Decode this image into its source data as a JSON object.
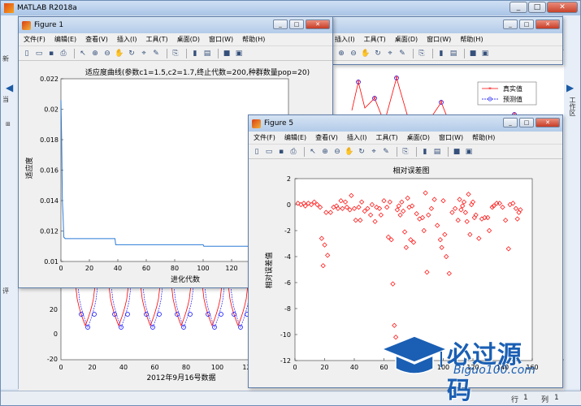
{
  "main_window": {
    "title": "MATLAB R2018a",
    "left_labels": [
      "新",
      "当",
      "评"
    ],
    "right_label": "工作区",
    "status_row_label": "行",
    "status_row_value": "1",
    "status_col_label": "列",
    "status_col_value": "1"
  },
  "menus": [
    "文件(F)",
    "编辑(E)",
    "查看(V)",
    "插入(I)",
    "工具(T)",
    "桌面(D)",
    "窗口(W)",
    "帮助(H)"
  ],
  "background_plot": {
    "xlabel": "2012年9月16号数据",
    "y_ticks": [
      "40",
      "20",
      "0",
      "-20"
    ],
    "x_ticks": [
      "0",
      "20",
      "40",
      "60",
      "80",
      "100",
      "120",
      "14"
    ],
    "legend": [
      "真实值",
      "预测值"
    ],
    "colors": {
      "real": "#ff0000",
      "pred": "#0000ff"
    }
  },
  "figure1": {
    "title": "Figure 1",
    "chart_data": {
      "type": "line",
      "title": "适应度曲线(参数c1=1.5,c2=1.7,终止代数=200,种群数量pop=20)",
      "xlabel": "进化代数",
      "ylabel": "适应度",
      "xlim": [
        0,
        160
      ],
      "ylim": [
        0.01,
        0.022
      ],
      "y_ticks": [
        "0.022",
        "0.02",
        "0.018",
        "0.016",
        "0.014",
        "0.012",
        "0.01"
      ],
      "x_ticks": [
        "0",
        "20",
        "40",
        "60",
        "80",
        "100",
        "120",
        "140"
      ],
      "series": [
        {
          "color": "#2b7bd6",
          "x": [
            0,
            0.5,
            1,
            1.5,
            2,
            3,
            20,
            38,
            38.5,
            60,
            100,
            100.5,
            160
          ],
          "y": [
            0.0206,
            0.018,
            0.014,
            0.013,
            0.0116,
            0.0115,
            0.0115,
            0.0115,
            0.0111,
            0.0111,
            0.0111,
            0.011,
            0.011
          ]
        }
      ]
    }
  },
  "figure5": {
    "title": "Figure 5",
    "chart_data": {
      "type": "scatter",
      "title": "相对误差图",
      "xlabel": "",
      "ylabel": "相对误差值",
      "xlim": [
        0,
        160
      ],
      "ylim": [
        -12,
        2
      ],
      "y_ticks": [
        "2",
        "0",
        "-2",
        "-4",
        "-6",
        "-8",
        "-10",
        "-12"
      ],
      "x_ticks": [
        "0",
        "20",
        "40",
        "60",
        "80",
        "100",
        "120",
        "140",
        "160"
      ],
      "marker": "diamond",
      "color": "#ff0000",
      "x": [
        2,
        4,
        6,
        7,
        9,
        11,
        13,
        15,
        17,
        18,
        19,
        20,
        21,
        22,
        24,
        26,
        28,
        29,
        31,
        32,
        34,
        35,
        37,
        38,
        40,
        41,
        43,
        44,
        45,
        47,
        49,
        51,
        52,
        54,
        55,
        57,
        58,
        60,
        62,
        63,
        64,
        65,
        66,
        67,
        68,
        69,
        70,
        71,
        72,
        73,
        74,
        75,
        76,
        77,
        78,
        79,
        80,
        82,
        84,
        86,
        87,
        88,
        89,
        90,
        92,
        94,
        96,
        98,
        99,
        100,
        101,
        102,
        104,
        106,
        108,
        110,
        111,
        112,
        113,
        114,
        115,
        116,
        117,
        118,
        119,
        120,
        121,
        122,
        124,
        126,
        128,
        130,
        131,
        133,
        134,
        136,
        138,
        140,
        142,
        144,
        145,
        147,
        149,
        150,
        151,
        152
      ],
      "y": [
        0.1,
        0.0,
        0.1,
        -0.1,
        0.1,
        0.0,
        0.2,
        0.0,
        -0.2,
        -2.6,
        -4.7,
        -3.1,
        -0.6,
        -3.9,
        -0.6,
        -0.2,
        -0.1,
        -0.3,
        0.3,
        -0.3,
        0.2,
        -0.2,
        -0.4,
        0.7,
        -0.3,
        -1.2,
        -0.2,
        -1.2,
        0.2,
        -0.5,
        -0.3,
        -0.8,
        0.0,
        -1.3,
        -0.2,
        -0.3,
        -0.8,
        0.3,
        -0.2,
        -2.5,
        0.2,
        -2.7,
        -6.1,
        -9.3,
        -10.2,
        -0.4,
        -0.1,
        -0.8,
        0.2,
        -0.5,
        -2.1,
        -3.3,
        0.5,
        -0.2,
        -2.7,
        -0.1,
        -2.9,
        -0.7,
        -1.1,
        -1.0,
        -2.0,
        0.9,
        -5.2,
        -0.8,
        -0.3,
        0.4,
        -1.6,
        -2.7,
        -3.3,
        0.3,
        -2.3,
        -4.0,
        -5.3,
        -0.6,
        -0.3,
        -1.2,
        0.4,
        -0.4,
        -0.1,
        0.2,
        -0.6,
        -1.3,
        0.8,
        -2.3,
        0.0,
        0.2,
        -1.0,
        -0.8,
        -2.6,
        -1.1,
        -1.0,
        -1.0,
        -2.0,
        -0.2,
        -0.1,
        0.1,
        0.1,
        -0.2,
        -1.2,
        -3.4,
        0.0,
        0.1,
        -0.3,
        -1.1,
        -0.6,
        -0.4
      ]
    }
  },
  "watermark": {
    "main": "必过源码",
    "sub": "Biguo100.com"
  }
}
